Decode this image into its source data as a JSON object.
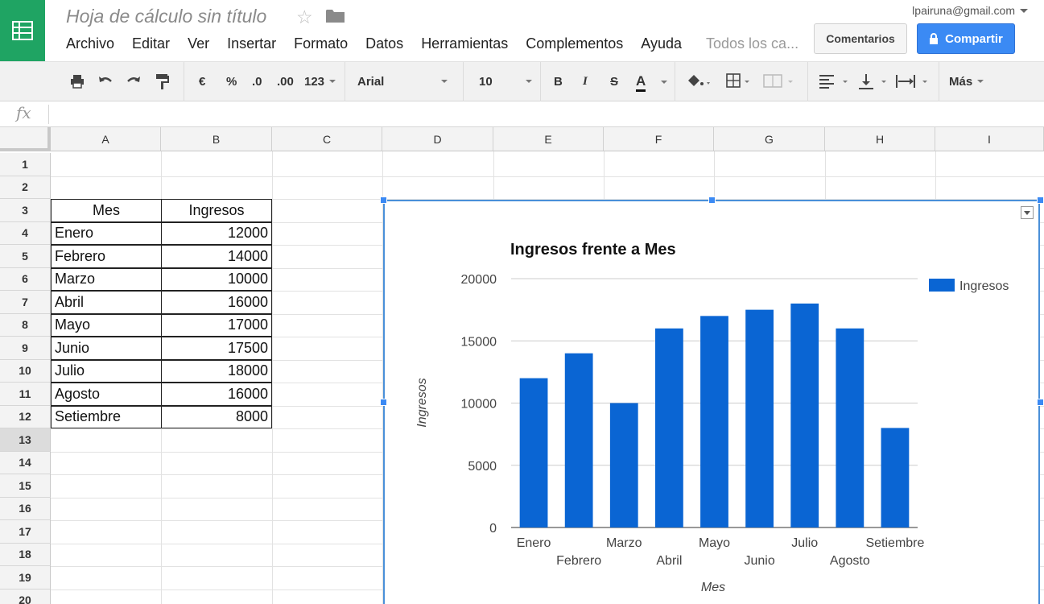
{
  "app": {
    "doc_title": "Hoja de cálculo sin título",
    "account": "lpairuna@gmail.com",
    "comments_button": "Comentarios",
    "share_button": "Compartir",
    "logo_color": "#1fa463",
    "accent": "#3b8af4"
  },
  "menu": [
    "Archivo",
    "Editar",
    "Ver",
    "Insertar",
    "Formato",
    "Datos",
    "Herramientas",
    "Complementos",
    "Ayuda"
  ],
  "menu_hint": "Todos los ca...",
  "toolbar": {
    "currency": "€",
    "percent": "%",
    "dec_less": ".0",
    "dec_more": ".00",
    "number_format": "123",
    "font": "Arial",
    "font_size": "10",
    "bold": "B",
    "italic": "I",
    "strike": "S",
    "text_color": "A",
    "more": "Más"
  },
  "fx_label": "fx",
  "columns": [
    "A",
    "B",
    "C",
    "D",
    "E",
    "F",
    "G",
    "H",
    "I"
  ],
  "rows": [
    "1",
    "2",
    "3",
    "4",
    "5",
    "6",
    "7",
    "8",
    "9",
    "10",
    "11",
    "12",
    "13",
    "14",
    "15",
    "16",
    "17",
    "18",
    "19",
    "20"
  ],
  "selected_row": "13",
  "table": {
    "header": [
      "Mes",
      "Ingresos"
    ],
    "rows": [
      [
        "Enero",
        "12000"
      ],
      [
        "Febrero",
        "14000"
      ],
      [
        "Marzo",
        "10000"
      ],
      [
        "Abril",
        "16000"
      ],
      [
        "Mayo",
        "17000"
      ],
      [
        "Junio",
        "17500"
      ],
      [
        "Julio",
        "18000"
      ],
      [
        "Agosto",
        "16000"
      ],
      [
        "Setiembre",
        "8000"
      ]
    ]
  },
  "chart_data": {
    "type": "bar",
    "title": "Ingresos frente a Mes",
    "xlabel": "Mes",
    "ylabel": "Ingresos",
    "categories": [
      "Enero",
      "Febrero",
      "Marzo",
      "Abril",
      "Mayo",
      "Junio",
      "Julio",
      "Agosto",
      "Setiembre"
    ],
    "series": [
      {
        "name": "Ingresos",
        "values": [
          12000,
          14000,
          10000,
          16000,
          17000,
          17500,
          18000,
          16000,
          8000
        ],
        "color": "#0a65d3"
      }
    ],
    "ylim": [
      0,
      20000
    ],
    "yticks": [
      "0",
      "5000",
      "10000",
      "15000",
      "20000"
    ],
    "grid": true,
    "legend": "right"
  }
}
